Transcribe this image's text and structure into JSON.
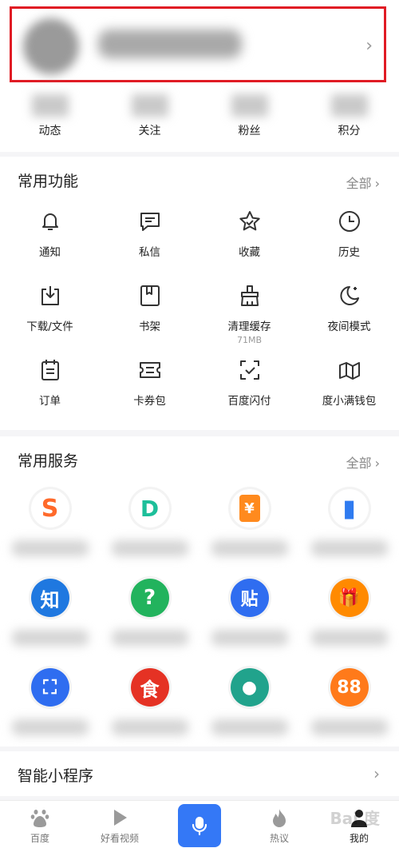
{
  "profile": {
    "chevron": "›"
  },
  "stats": [
    {
      "label": "动态"
    },
    {
      "label": "关注"
    },
    {
      "label": "粉丝"
    },
    {
      "label": "积分"
    }
  ],
  "features": {
    "title": "常用功能",
    "more": "全部",
    "items": [
      {
        "label": "通知",
        "icon": "bell-icon"
      },
      {
        "label": "私信",
        "icon": "message-icon"
      },
      {
        "label": "收藏",
        "icon": "star-icon"
      },
      {
        "label": "历史",
        "icon": "clock-icon"
      },
      {
        "label": "下载/文件",
        "icon": "download-icon"
      },
      {
        "label": "书架",
        "icon": "bookshelf-icon"
      },
      {
        "label": "清理缓存",
        "sub": "71MB",
        "icon": "broom-icon"
      },
      {
        "label": "夜间模式",
        "icon": "moon-icon"
      },
      {
        "label": "订单",
        "icon": "order-icon"
      },
      {
        "label": "卡券包",
        "icon": "coupon-icon"
      },
      {
        "label": "百度闪付",
        "icon": "scan-pay-icon"
      },
      {
        "label": "度小满钱包",
        "icon": "wallet-icon"
      }
    ]
  },
  "services": {
    "title": "常用服务",
    "more": "全部",
    "items": [
      {
        "icon": "s-logo-icon",
        "glyph": "S",
        "color": "#ff6a2b"
      },
      {
        "icon": "health-icon",
        "glyph": "D",
        "color": "#1dbf9a"
      },
      {
        "icon": "red-envelope-icon",
        "glyph": "¥",
        "color": "#ff8a1e"
      },
      {
        "icon": "building-icon",
        "glyph": "▮",
        "color": "#2f7bf0"
      },
      {
        "icon": "zhidao-icon",
        "glyph": "知",
        "color": "#1f78e0"
      },
      {
        "icon": "question-icon",
        "glyph": "?",
        "color": "#22b35d"
      },
      {
        "icon": "tieba-icon",
        "glyph": "贴",
        "color": "#2f6df0"
      },
      {
        "icon": "gift-icon",
        "glyph": "🎁",
        "color": "#ff8a00"
      },
      {
        "icon": "scan-icon",
        "glyph": "⛶",
        "color": "#2f6df0"
      },
      {
        "icon": "food-icon",
        "glyph": "食",
        "color": "#e53224"
      },
      {
        "icon": "mushroom-icon",
        "glyph": "●",
        "color": "#21a38c"
      },
      {
        "icon": "88-icon",
        "glyph": "88",
        "color": "#ff7a1a"
      }
    ]
  },
  "mini": {
    "title": "智能小程序",
    "chevron": "›"
  },
  "tabbar": [
    {
      "label": "百度",
      "icon": "baidu-paw-icon"
    },
    {
      "label": "好看视频",
      "icon": "play-icon"
    },
    {
      "label": "",
      "icon": "microphone-icon"
    },
    {
      "label": "热议",
      "icon": "flame-icon"
    },
    {
      "label": "我的",
      "icon": "user-icon"
    }
  ],
  "watermark": "Bai  度"
}
